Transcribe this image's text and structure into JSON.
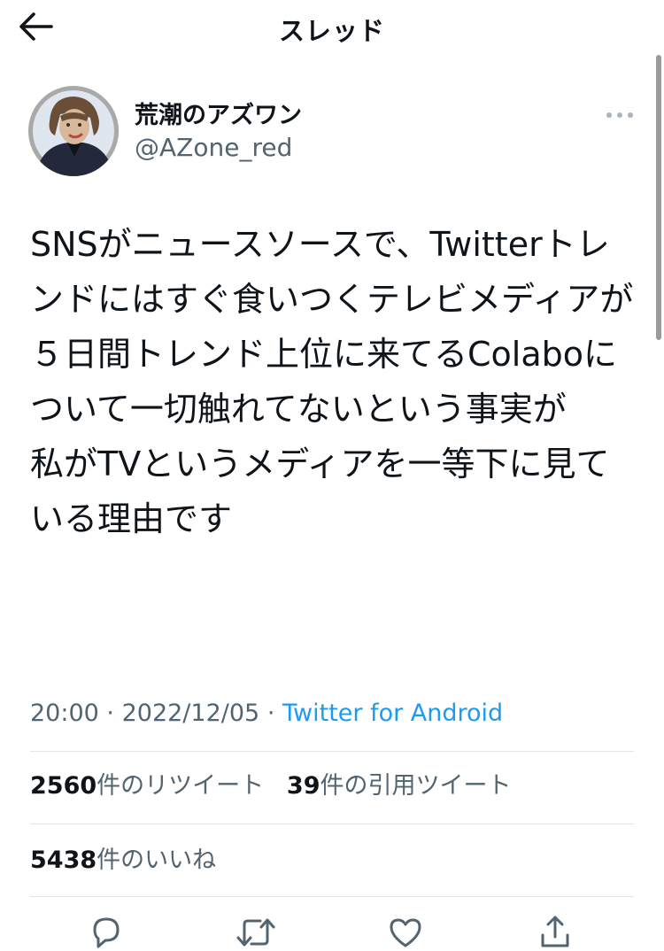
{
  "header": {
    "title": "スレッド",
    "back_icon": "arrow-left-icon"
  },
  "author": {
    "name": "荒潮のアズワン",
    "handle": "@AZone_red",
    "avatar_icon": "user-avatar",
    "more_icon": "more-horizontal-icon"
  },
  "tweet": {
    "text": "SNSがニュースソースで、Twitterトレンドにはすぐ食いつくテレビメディアが\n５日間トレンド上位に来てるColaboについて一切触れてないという事実が\n私がTVというメディアを一等下に見ている理由です"
  },
  "meta": {
    "time": "20:00",
    "separator": "·",
    "date": "2022/12/05",
    "source": "Twitter for Android"
  },
  "stats": {
    "retweets_count": "2560",
    "retweets_label": "件のリツイート",
    "quotes_count": "39",
    "quotes_label": "件の引用ツイート",
    "likes_count": "5438",
    "likes_label": "件のいいね"
  },
  "actions": {
    "reply_icon": "reply-icon",
    "retweet_icon": "retweet-icon",
    "like_icon": "heart-icon",
    "share_icon": "share-icon"
  },
  "colors": {
    "text": "#0f1419",
    "secondary": "#536471",
    "link": "#1d9bf0",
    "divider": "#e1e6ea"
  }
}
